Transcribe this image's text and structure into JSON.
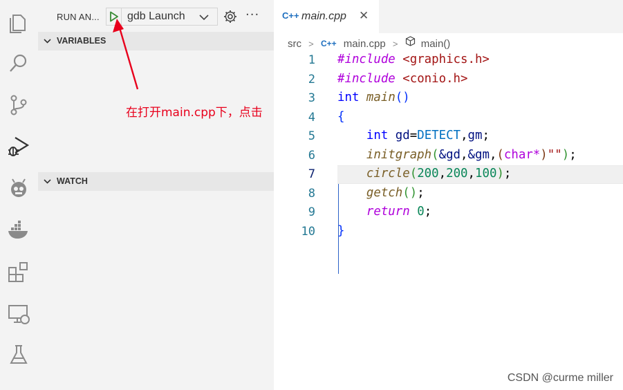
{
  "activity_bar": {
    "icons": [
      "files-icon",
      "search-icon",
      "source-control-icon",
      "run-debug-icon",
      "platformio-icon",
      "docker-icon",
      "extensions-icon",
      "remote-explorer-icon",
      "testing-icon"
    ]
  },
  "sidebar": {
    "title": "RUN AN...",
    "launch_config": "gdb Launch",
    "more_label": "···",
    "sections": {
      "variables": "VARIABLES",
      "watch": "WATCH"
    }
  },
  "annotation": {
    "text": "在打开main.cpp下，点击",
    "color": "#e8001c"
  },
  "editor": {
    "tab": {
      "icon": "C++",
      "label": "main.cpp",
      "close": "✕"
    },
    "breadcrumb": {
      "folder": "src",
      "file_icon": "C++",
      "file": "main.cpp",
      "symbol": "main()"
    },
    "active_line": 7,
    "lines": [
      {
        "no": "1"
      },
      {
        "no": "2"
      },
      {
        "no": "3"
      },
      {
        "no": "4"
      },
      {
        "no": "5"
      },
      {
        "no": "6"
      },
      {
        "no": "7"
      },
      {
        "no": "8"
      },
      {
        "no": "9"
      },
      {
        "no": "10"
      }
    ],
    "code": {
      "l1_directive": "#include",
      "l1_header": "<graphics.h>",
      "l2_directive": "#include",
      "l2_header": "<conio.h>",
      "l3_type": "int",
      "l3_fn": "main",
      "l3_parens": "()",
      "l4_brace": "{",
      "l5_type": "int",
      "l5_rest_a": "gd",
      "l5_eq": "=",
      "l5_macro": "DETECT",
      "l5_comma": ",",
      "l5_rest_b": "gm",
      "l5_semi": ";",
      "l6_fn": "initgraph",
      "l6_open": "(",
      "l6_amp1": "&gd",
      "l6_c1": ",",
      "l6_amp2": "&gm",
      "l6_c2": ",",
      "l6_copen": "(",
      "l6_type": "char*",
      "l6_cclose": ")",
      "l6_str": "\"\"",
      "l6_close": ")",
      "l6_semi": ";",
      "l7_fn": "circle",
      "l7_open": "(",
      "l7_n1": "200",
      "l7_c1": ",",
      "l7_n2": "200",
      "l7_c2": ",",
      "l7_n3": "100",
      "l7_close": ")",
      "l7_semi": ";",
      "l8_fn": "getch",
      "l8_parens": "()",
      "l8_semi": ";",
      "l9_kw": "return",
      "l9_num": "0",
      "l9_semi": ";",
      "l10_brace": "}"
    }
  },
  "watermark": "CSDN @curme miller"
}
